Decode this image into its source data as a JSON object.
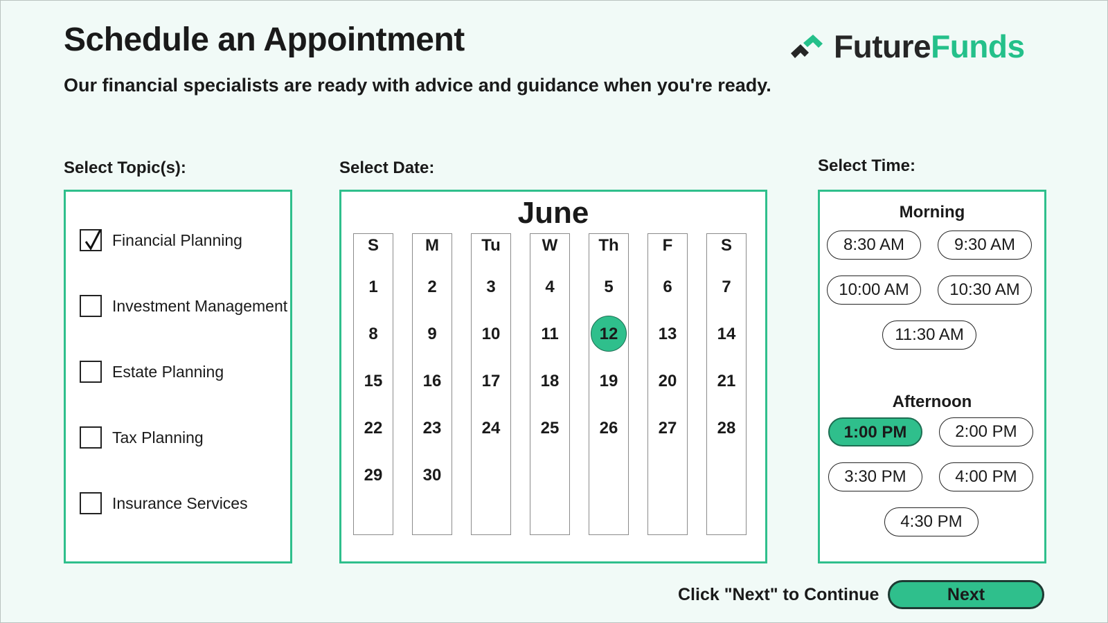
{
  "header": {
    "title": "Schedule an Appointment",
    "subtitle": "Our financial specialists are ready with advice and guidance when you're ready.",
    "logo_part1": "Future",
    "logo_part2": "Funds"
  },
  "colors": {
    "accent": "#2fbf8c",
    "brand_green": "#24c08a",
    "background": "#f1faf7"
  },
  "topics": {
    "label": "Select Topic(s):",
    "items": [
      {
        "label": "Financial Planning",
        "checked": true
      },
      {
        "label": "Investment Management",
        "checked": false
      },
      {
        "label": "Estate Planning",
        "checked": false
      },
      {
        "label": "Tax Planning",
        "checked": false
      },
      {
        "label": "Insurance Services",
        "checked": false
      }
    ]
  },
  "calendar": {
    "label": "Select Date:",
    "month": "June",
    "weekdays": [
      "S",
      "M",
      "Tu",
      "W",
      "Th",
      "F",
      "S"
    ],
    "weeks": [
      [
        "1",
        "2",
        "3",
        "4",
        "5",
        "6",
        "7"
      ],
      [
        "8",
        "9",
        "10",
        "11",
        "12",
        "13",
        "14"
      ],
      [
        "15",
        "16",
        "17",
        "18",
        "19",
        "20",
        "21"
      ],
      [
        "22",
        "23",
        "24",
        "25",
        "26",
        "27",
        "28"
      ],
      [
        "29",
        "30",
        "",
        "",
        "",
        "",
        ""
      ]
    ],
    "selected_day": "12"
  },
  "times": {
    "label": "Select Time:",
    "morning_label": "Morning",
    "morning": [
      "8:30 AM",
      "9:30 AM",
      "10:00 AM",
      "10:30 AM",
      "11:30 AM"
    ],
    "afternoon_label": "Afternoon",
    "afternoon": [
      "1:00 PM",
      "2:00 PM",
      "3:30 PM",
      "4:00 PM",
      "4:30 PM"
    ],
    "selected": "1:00 PM"
  },
  "footer": {
    "continue_text": "Click \"Next\" to Continue",
    "next_label": "Next"
  }
}
